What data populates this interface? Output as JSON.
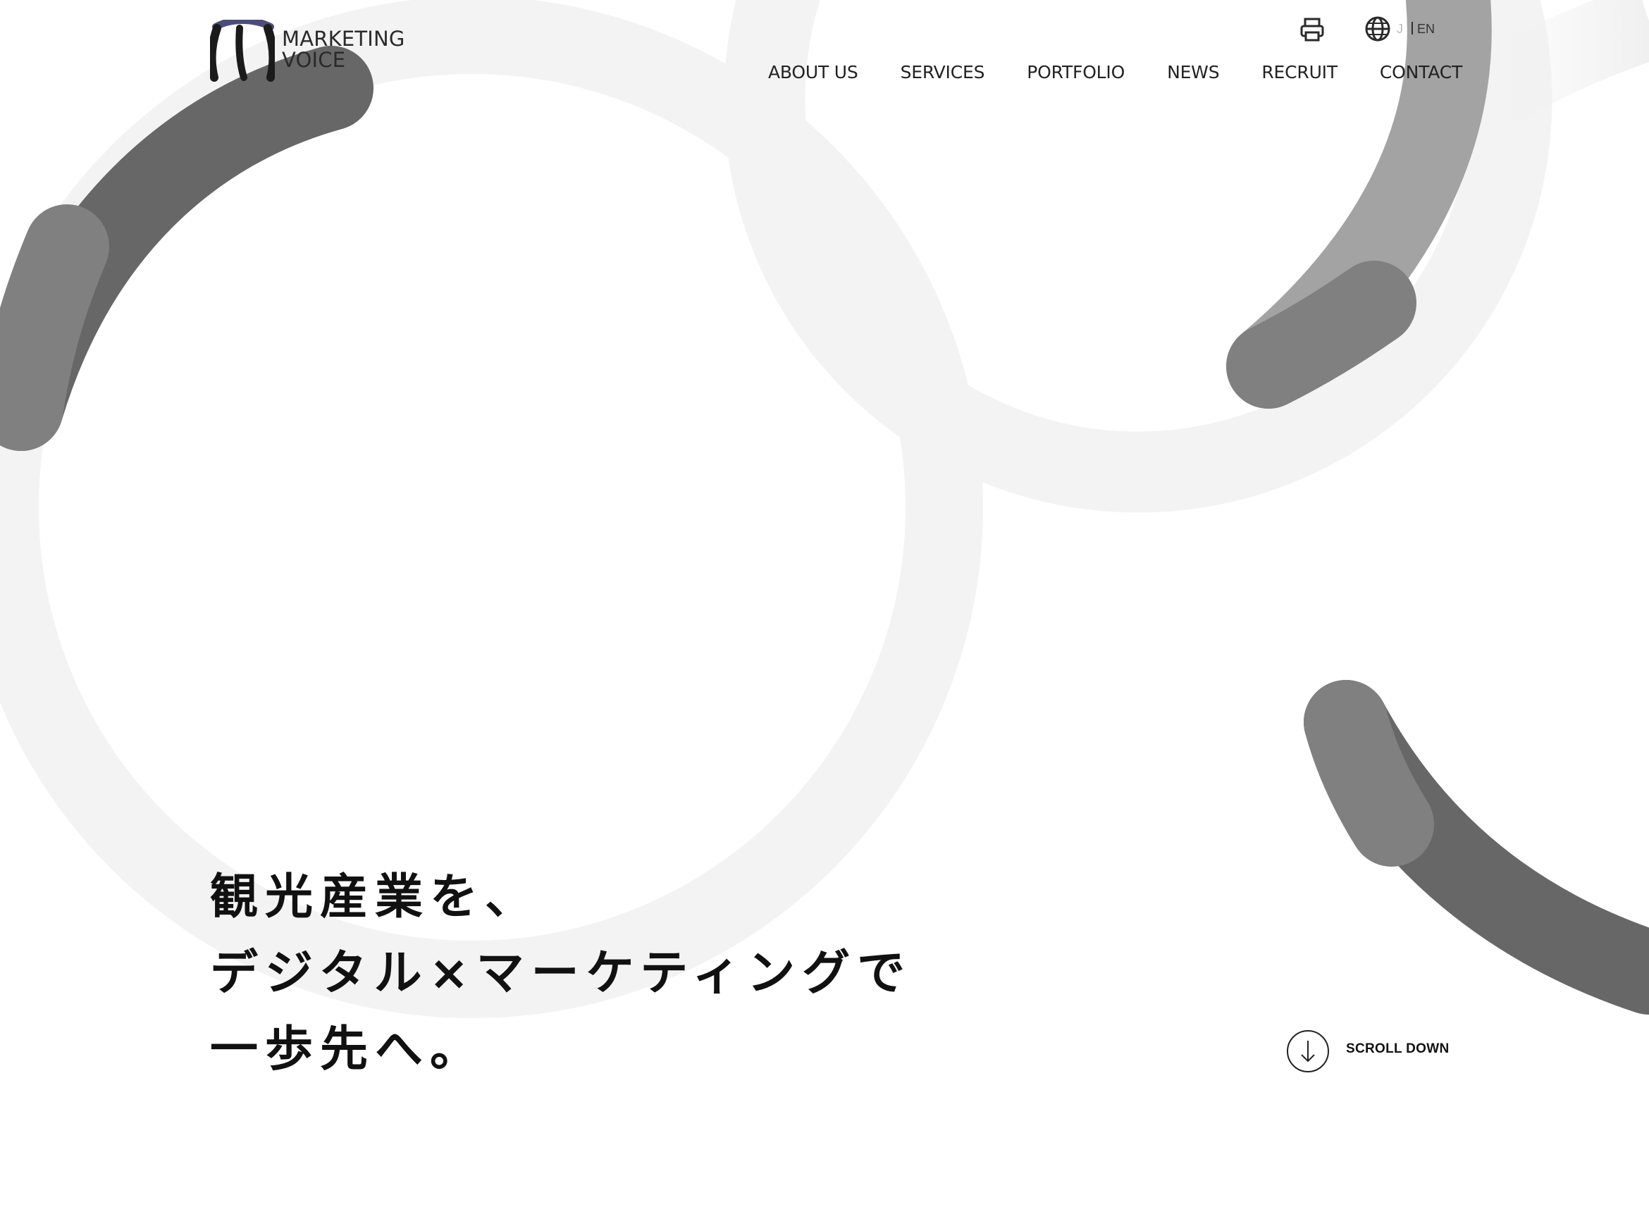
{
  "header": {
    "logo": {
      "line1": "MARKETING",
      "line2": "VOICE",
      "icon": "marketing-voice-m-logo"
    },
    "utility": {
      "print_icon": "printer-icon",
      "language_icon": "globe-icon",
      "languages": {
        "ja": "J",
        "en": "EN"
      }
    },
    "nav": {
      "items": [
        {
          "label": "ABOUT US"
        },
        {
          "label": "SERVICES"
        },
        {
          "label": "PORTFOLIO"
        },
        {
          "label": "NEWS"
        },
        {
          "label": "RECRUIT"
        },
        {
          "label": "CONTACT"
        }
      ]
    }
  },
  "hero": {
    "lines": [
      "観光産業を、",
      "デジタル×マーケティングで",
      "一歩先へ。"
    ]
  },
  "scroll": {
    "label": "SCROLL DOWN",
    "icon": "arrow-down-circle-icon"
  },
  "colors": {
    "background": "#ffffff",
    "text": "#111111",
    "logo_arc": "#4b4d78",
    "ring_light": "#f0f0f0",
    "ring_dark": "#676767",
    "ring_mid": "#808080"
  }
}
